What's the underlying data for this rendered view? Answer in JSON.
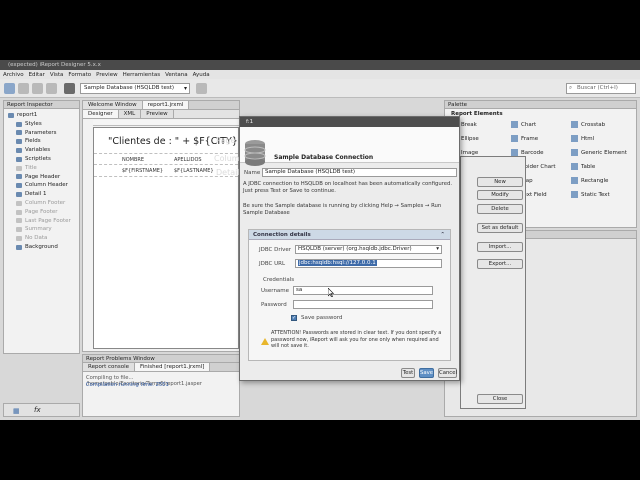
{
  "window": {
    "title": "(expected) iReport Designer 5.x.x"
  },
  "menu": [
    "Archivo",
    "Editar",
    "Vista",
    "Formato",
    "Preview",
    "Herramientas",
    "Ventana",
    "Ayuda"
  ],
  "toolbar": {
    "db_select": "Sample Database (HSQLDB test)",
    "search_placeholder": "Buscar (Ctrl+I)"
  },
  "report_inspector": {
    "title": "Report Inspector",
    "items": [
      {
        "label": "report1",
        "dim": false
      },
      {
        "label": "Styles",
        "dim": false
      },
      {
        "label": "Parameters",
        "dim": false
      },
      {
        "label": "Fields",
        "dim": false
      },
      {
        "label": "Variables",
        "dim": false
      },
      {
        "label": "Scriptlets",
        "dim": false
      },
      {
        "label": "Title",
        "dim": true
      },
      {
        "label": "Page Header",
        "dim": false
      },
      {
        "label": "Column Header",
        "dim": false
      },
      {
        "label": "Detail 1",
        "dim": false
      },
      {
        "label": "Column Footer",
        "dim": true
      },
      {
        "label": "Page Footer",
        "dim": true
      },
      {
        "label": "Last Page Footer",
        "dim": true
      },
      {
        "label": "Summary",
        "dim": true
      },
      {
        "label": "No Data",
        "dim": true
      },
      {
        "label": "Background",
        "dim": false
      }
    ]
  },
  "editor": {
    "doc_tabs": [
      "Welcome Window",
      "report1.jrxml"
    ],
    "view_tabs": [
      "Designer",
      "XML",
      "Preview"
    ],
    "title_expr": "\"Clientes de : \" + $F{CITY}",
    "col_headers": [
      "NOMBRE",
      "APELLIDOS"
    ],
    "col_fields": [
      "$F{FIRSTNAME}",
      "$F{LASTNAME}"
    ],
    "ghost_page": "Page",
    "ghost_column": "Column",
    "ghost_detail": "Detail"
  },
  "problems": {
    "title": "Report Problems Window",
    "tabs": [
      "Report console",
      "Finished [report1.jrxml]"
    ],
    "lines": [
      "Compiling to file... /home/pablo/Escritorio/Temo6/report1.jasper",
      "Compilation running time: 2551"
    ]
  },
  "palette": {
    "title": "Palette",
    "section": "Report Elements",
    "items": [
      [
        "Break",
        "Chart",
        "Crosstab"
      ],
      [
        "Ellipse",
        "Frame",
        "Html"
      ],
      [
        "Image",
        "Barcode",
        "Generic Element"
      ],
      [
        "Line",
        "Spider Chart",
        "Table"
      ],
      [
        "List",
        "Map",
        "Rectangle"
      ],
      [
        "Subreport",
        "Text Field",
        "Static Text"
      ]
    ]
  },
  "right_dialog": {
    "buttons": [
      "New",
      "Modify",
      "Delete",
      "Set as default",
      "Import...",
      "Export...",
      "Close"
    ]
  },
  "dialog": {
    "title": "Sample Database Connection",
    "icon_title_label": "f:1",
    "name_label": "Name",
    "name_value": "Sample Database (HSQLDB test)",
    "description": "A JDBC connection to HSQLDB on localhost has been automatically configured. Just press Test or Save to continue.",
    "instructions": "Be sure the Sample database is running by clicking Help → Samples → Run Sample Database",
    "section_title": "Connection details",
    "driver_label": "JDBC Driver",
    "driver_value": "HSQLDB (server) (org.hsqldb.jdbc.Driver)",
    "url_label": "JDBC URL",
    "url_value": "jdbc:hsqldb:hsql://127.0.0.1",
    "credentials_label": "Credentials",
    "username_label": "Username",
    "username_value": "sa",
    "password_label": "Password",
    "password_value": "",
    "save_password_label": "Save password",
    "attention_text": "ATTENTION! Passwords are stored in clear text. If you dont specify a password now, iReport will ask you for one only when required and will not save it.",
    "buttons": {
      "test": "Test",
      "save": "Save",
      "cancel": "Cancel"
    }
  }
}
